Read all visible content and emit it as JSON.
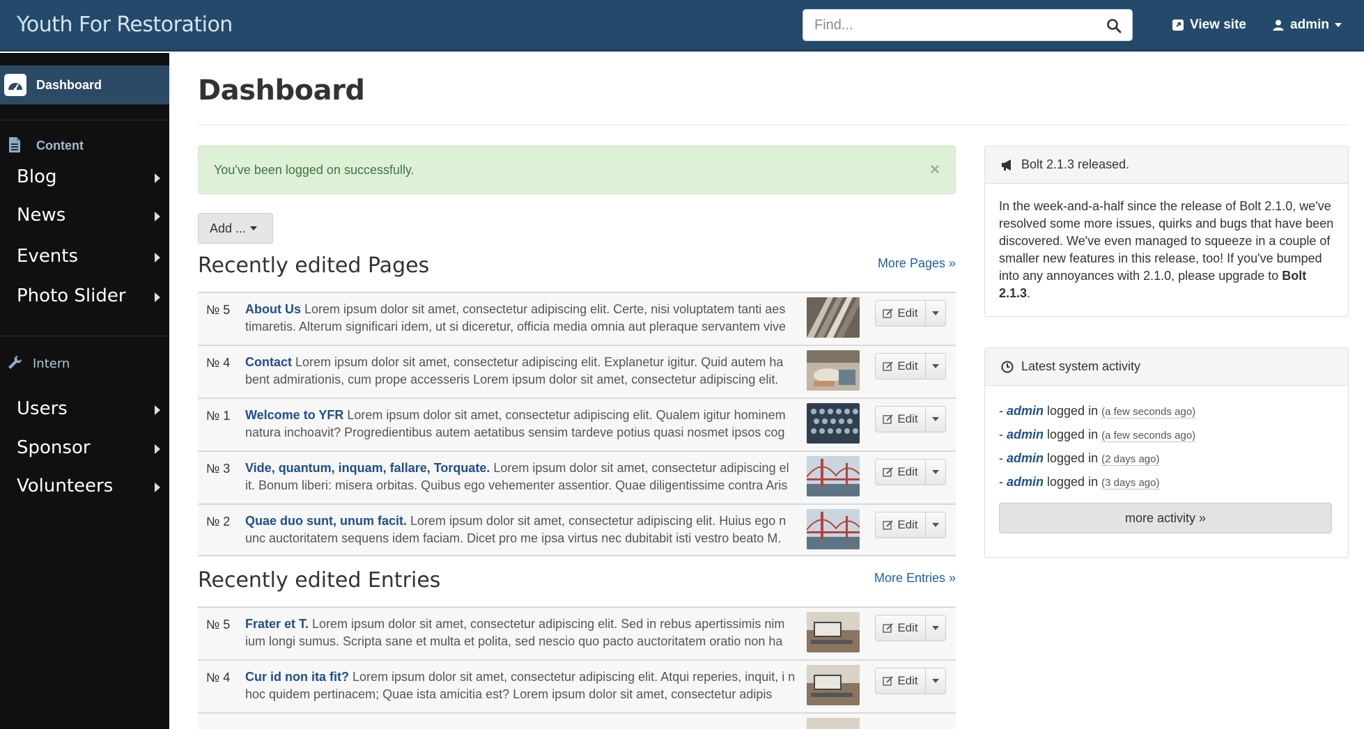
{
  "header": {
    "brand": "Youth For Restoration",
    "search_placeholder": "Find...",
    "view_site": "View site",
    "user": "admin"
  },
  "sidebar": {
    "dashboard": "Dashboard",
    "content_section": "Content",
    "content_items": [
      {
        "label": "Blog"
      },
      {
        "label": "News"
      },
      {
        "label": "Events"
      },
      {
        "label": "Photo Slider"
      }
    ],
    "intern_section": "Intern",
    "intern_items": [
      {
        "label": "Users"
      },
      {
        "label": "Sponsor"
      },
      {
        "label": "Volunteers"
      }
    ]
  },
  "main": {
    "title": "Dashboard",
    "alert": "You've been logged on successfully.",
    "alert_close": "×",
    "add_button": "Add ...",
    "edit_label": "Edit",
    "pages": {
      "title": "Recently edited Pages",
      "more": "More Pages »",
      "rows": [
        {
          "num": "№ 5",
          "title": "About Us",
          "excerpt": " Lorem ipsum dolor sit amet, consectetur adipiscing elit. Certe, nisi voluptatem tanti aes timaretis. Alterum significari idem, ut si diceretur, officia media omnia aut pleraque servantem vive"
        },
        {
          "num": "№ 4",
          "title": "Contact",
          "excerpt": " Lorem ipsum dolor sit amet, consectetur adipiscing elit. Explanetur igitur. Quid autem ha bent admirationis, cum prope accesseris Lorem ipsum dolor sit amet, consectetur adipiscing elit."
        },
        {
          "num": "№ 1",
          "title": "Welcome to YFR",
          "excerpt": " Lorem ipsum dolor sit amet, consectetur adipiscing elit. Qualem igitur hominem natura inchoavit? Progredientibus autem aetatibus sensim tardeve potius quasi nosmet ipsos cog"
        },
        {
          "num": "№ 3",
          "title": "Vide, quantum, inquam, fallare, Torquate.",
          "excerpt": " Lorem ipsum dolor sit amet, consectetur adipiscing el it. Bonum liberi: misera orbitas. Quibus ego vehementer assentior. Quae diligentissime contra Aris"
        },
        {
          "num": "№ 2",
          "title": "Quae duo sunt, unum facit.",
          "excerpt": " Lorem ipsum dolor sit amet, consectetur adipiscing elit. Huius ego n unc auctoritatem sequens idem faciam. Dicet pro me ipsa virtus nec dubitabit isti vestro beato M."
        }
      ]
    },
    "entries": {
      "title": "Recently edited Entries",
      "more": "More Entries »",
      "rows": [
        {
          "num": "№ 5",
          "title": "Frater et T.",
          "excerpt": " Lorem ipsum dolor sit amet, consectetur adipiscing elit. Sed in rebus apertissimis nim ium longi sumus. Scripta sane et multa et polita, sed nescio quo pacto auctoritatem oratio non ha"
        },
        {
          "num": "№ 4",
          "title": "Cur id non ita fit?",
          "excerpt": " Lorem ipsum dolor sit amet, consectetur adipiscing elit. Atqui reperies, inquit, i n hoc quidem pertinacem; Quae ista amicitia est? Lorem ipsum dolor sit amet, consectetur adipis"
        }
      ]
    }
  },
  "news_panel": {
    "title": "Bolt 2.1.3 released.",
    "body": "In the week-and-a-half since the release of Bolt 2.1.0, we've resolved some more issues, quirks and bugs that have been discovered. We've even managed to squeeze in a couple of smaller new features in this release, too! If you've bumped into any annoyances with 2.1.0, please upgrade to ",
    "body_bold": "Bolt 2.1.3",
    "body_end": "."
  },
  "activity_panel": {
    "title": "Latest system activity",
    "items": [
      {
        "user": "admin",
        "action": " logged in ",
        "ago": "(a few seconds ago)"
      },
      {
        "user": "admin",
        "action": " logged in ",
        "ago": "(a few seconds ago)"
      },
      {
        "user": "admin",
        "action": " logged in ",
        "ago": "(2 days ago)"
      },
      {
        "user": "admin",
        "action": " logged in ",
        "ago": "(3 days ago)"
      }
    ],
    "more": "more activity »"
  },
  "colors": {
    "topbar": "#234a6b",
    "sidebar": "#101010",
    "sidebar_active": "#2c4a65",
    "link": "#1e4f8c",
    "alert_bg": "#dff0d8"
  }
}
